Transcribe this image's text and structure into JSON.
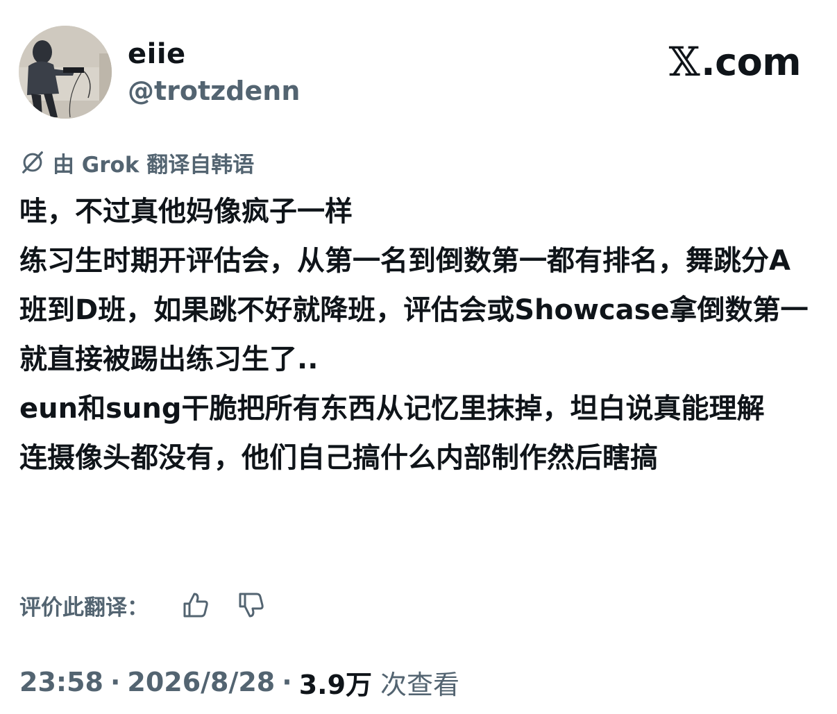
{
  "author": {
    "display_name": "eiie",
    "handle": "@trotzdenn"
  },
  "site": {
    "logo_mark": "𝕏",
    "logo_text": ".com"
  },
  "translation": {
    "note": "由 Grok 翻译自韩语",
    "icon": "grok-icon"
  },
  "post": {
    "text": "哇，不过真他妈像疯子一样\n练习生时期开评估会，从第一名到倒数第一都有排名，舞跳分A班到D班，如果跳不好就降班，评估会或Showcase拿倒数第一就直接被踢出练习生了..\neun和sung干脆把所有东西从记忆里抹掉，坦白说真能理解\n连摄像头都没有，他们自己搞什么内部制作然后瞎搞"
  },
  "rating": {
    "label": "评价此翻译：",
    "up_icon": "thumbs-up-icon",
    "down_icon": "thumbs-down-icon"
  },
  "meta": {
    "time": "23:58",
    "separator": "·",
    "date": "2026/8/28",
    "views_count": "3.9万",
    "views_label": "次查看"
  },
  "colors": {
    "text_primary": "#0f1419",
    "text_secondary": "#536471",
    "background": "#ffffff"
  }
}
